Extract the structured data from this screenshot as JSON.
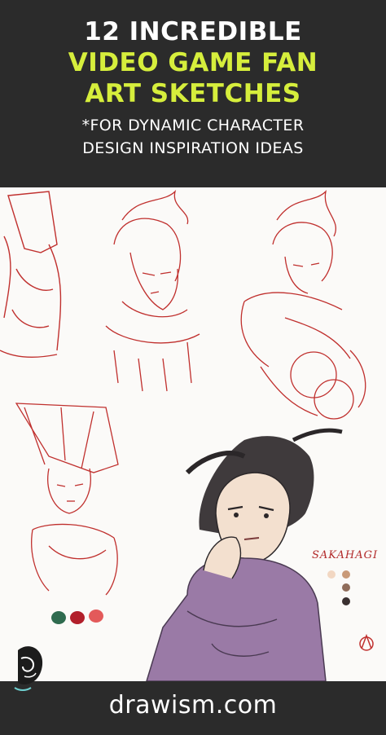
{
  "header": {
    "line1": "12  INCREDIBLE",
    "line2": "VIDEO GAME FAN",
    "line3": "ART SKETCHES",
    "sub1": "*FOR DYNAMIC CHARACTER",
    "sub2": "DESIGN INSPIRATION IDEAS"
  },
  "artwork": {
    "signature_label": "SAKAHAGI",
    "swatch_colors_left": [
      "#2f6b4f",
      "#b21f2b",
      "#e35a5a"
    ],
    "swatch_colors_right": [
      "#f2d7c2",
      "#c99a78",
      "#8f6c5a",
      "#3a3030"
    ],
    "sketch_color": "#c0302e",
    "fill_color": "#9a7aa6"
  },
  "footer": {
    "site": "drawism.com"
  },
  "icons": {
    "logo": "drawism-logo-icon",
    "signature": "artist-signature-icon"
  }
}
